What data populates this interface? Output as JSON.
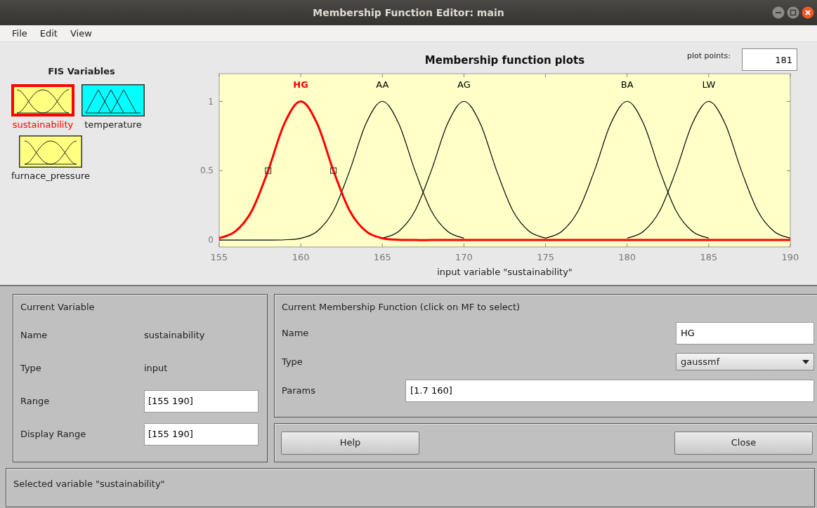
{
  "window": {
    "title": "Membership Function Editor: main"
  },
  "menu": [
    "File",
    "Edit",
    "View"
  ],
  "fis_variables": {
    "title": "FIS Variables",
    "items": [
      {
        "name": "sustainability",
        "kind": "input",
        "selected": true
      },
      {
        "name": "temperature",
        "kind": "output",
        "selected": false
      },
      {
        "name": "furnace_pressure",
        "kind": "input",
        "selected": false
      }
    ]
  },
  "plot_points": {
    "label": "plot points:",
    "value": "181"
  },
  "plot": {
    "curve_states": [
      {
        "selected": true
      },
      {
        "selected": false
      },
      {
        "selected": false
      },
      {
        "selected": false
      },
      {
        "selected": false
      }
    ],
    "chart_data": {
      "type": "line",
      "title": "Membership function plots",
      "xlabel": "input variable \"sustainability\"",
      "x": [
        155,
        156,
        157,
        158,
        159,
        160,
        161,
        162,
        163,
        164,
        165,
        166,
        167,
        168,
        169,
        170,
        171,
        172,
        173,
        174,
        175,
        176,
        177,
        178,
        179,
        180,
        181,
        182,
        183,
        184,
        185,
        186,
        187,
        188,
        189,
        190
      ],
      "series": [
        {
          "name": "HG",
          "color": "#ff0000",
          "values": [
            0.013,
            0.063,
            0.211,
            0.501,
            0.841,
            1,
            0.841,
            0.501,
            0.211,
            0.063,
            0.013,
            0.002,
            0,
            0,
            0,
            0,
            0,
            0,
            0,
            0,
            0,
            0,
            0,
            0,
            0,
            0,
            0,
            0,
            0,
            0,
            0,
            0,
            0,
            0,
            0,
            0
          ]
        },
        {
          "name": "AA",
          "color": "#000000",
          "values": [
            0,
            0,
            0,
            0,
            0.002,
            0.013,
            0.063,
            0.211,
            0.501,
            0.841,
            1,
            0.841,
            0.501,
            0.211,
            0.063,
            0.013,
            null,
            null,
            null,
            null,
            null,
            null,
            null,
            null,
            null,
            null,
            null,
            null,
            null,
            null,
            null,
            null,
            null,
            null,
            null,
            null
          ]
        },
        {
          "name": "AG",
          "color": "#000000",
          "values": [
            null,
            null,
            null,
            null,
            null,
            null,
            null,
            null,
            null,
            null,
            0.013,
            0.063,
            0.211,
            0.501,
            0.841,
            1,
            0.841,
            0.501,
            0.211,
            0.063,
            0.013,
            null,
            null,
            null,
            null,
            null,
            null,
            null,
            null,
            null,
            null,
            null,
            null,
            null,
            null,
            null
          ]
        },
        {
          "name": "BA",
          "color": "#000000",
          "values": [
            null,
            null,
            null,
            null,
            null,
            null,
            null,
            null,
            null,
            null,
            null,
            null,
            null,
            null,
            null,
            null,
            null,
            null,
            null,
            null,
            0.013,
            0.063,
            0.211,
            0.501,
            0.841,
            1,
            0.841,
            0.501,
            0.211,
            0.063,
            0.013,
            null,
            null,
            null,
            null,
            null
          ]
        },
        {
          "name": "LW",
          "color": "#000000",
          "values": [
            null,
            null,
            null,
            null,
            null,
            null,
            null,
            null,
            null,
            null,
            null,
            null,
            null,
            null,
            null,
            null,
            null,
            null,
            null,
            null,
            null,
            null,
            null,
            null,
            null,
            0.013,
            0.063,
            0.211,
            0.501,
            0.841,
            1,
            0.841,
            0.501,
            0.211,
            0.063,
            0.013
          ]
        }
      ],
      "xlim": [
        155,
        190
      ],
      "ylim": [
        -0.05,
        1.2
      ],
      "xticks": [
        155,
        160,
        165,
        170,
        175,
        180,
        185,
        190
      ],
      "yticks": [
        0,
        0.5,
        1
      ]
    }
  },
  "current_variable": {
    "title": "Current Variable",
    "fields": [
      {
        "label": "Name",
        "value": "sustainability",
        "kind": "text"
      },
      {
        "label": "Type",
        "value": "input",
        "kind": "text"
      },
      {
        "label": "Range",
        "value": "[155 190]",
        "kind": "input"
      },
      {
        "label": "Display Range",
        "value": "[155 190]",
        "kind": "input"
      }
    ]
  },
  "current_mf": {
    "title": "Current Membership Function (click on MF to select)",
    "name": {
      "label": "Name",
      "value": "HG"
    },
    "type": {
      "label": "Type",
      "value": "gaussmf"
    },
    "params": {
      "label": "Params",
      "value": "[1.7 160]"
    }
  },
  "buttons": [
    "Help",
    "Close"
  ],
  "status_bar": "Selected variable \"sustainability\""
}
